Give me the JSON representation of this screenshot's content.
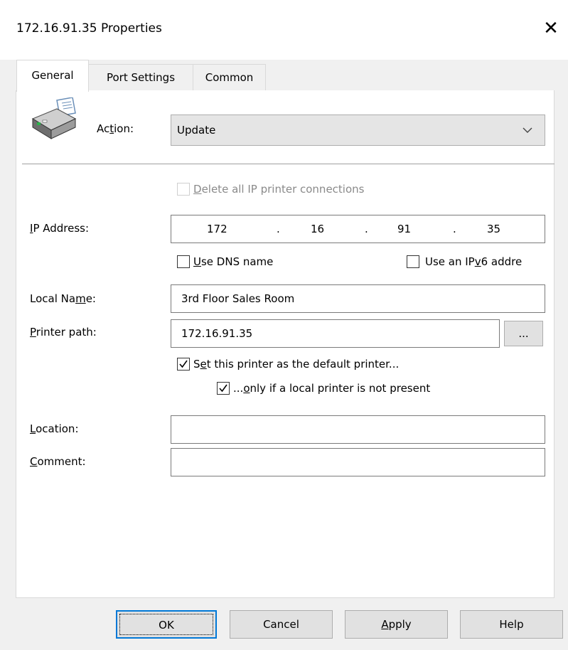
{
  "window": {
    "title": "172.16.91.35 Properties",
    "close_glyph": "✕"
  },
  "tabs": [
    {
      "label": "General",
      "active": true
    },
    {
      "label": "Port Settings",
      "active": false
    },
    {
      "label": "Common",
      "active": false
    }
  ],
  "general": {
    "action_label_pre": "Ac",
    "action_label_u": "t",
    "action_label_post": "ion:",
    "action_value": "Update",
    "delete_all_pre": "",
    "delete_all_u": "D",
    "delete_all_post": "elete all IP printer connections",
    "ip_label_u": "I",
    "ip_label_post": "P Address:",
    "ip_octets": [
      "172",
      "16",
      "91",
      "35"
    ],
    "use_dns_u": "U",
    "use_dns_post": "se DNS name",
    "use_ipv6_pre": "Use an IP",
    "use_ipv6_u": "v",
    "use_ipv6_post": "6 addre",
    "local_name_label_pre": "Local Na",
    "local_name_label_u": "m",
    "local_name_label_post": "e:",
    "local_name_value": "3rd Floor Sales Room",
    "printer_path_label_u": "P",
    "printer_path_label_post": "rinter path:",
    "printer_path_value": "172.16.91.35",
    "browse_label": "...",
    "set_default_pre": "S",
    "set_default_u": "e",
    "set_default_post": "t this printer as the default printer...",
    "only_if_pre": "...",
    "only_if_u": "o",
    "only_if_post": "nly if a local printer is not present",
    "location_label_u": "L",
    "location_label_post": "ocation:",
    "location_value": "",
    "comment_label_u": "C",
    "comment_label_post": "omment:",
    "comment_value": ""
  },
  "buttons": {
    "ok": "OK",
    "cancel": "Cancel",
    "apply_u": "A",
    "apply_post": "pply",
    "help": "Help"
  },
  "checkboxes": {
    "delete_all": false,
    "use_dns": false,
    "use_ipv6": false,
    "set_default": true,
    "only_if_local": true
  }
}
